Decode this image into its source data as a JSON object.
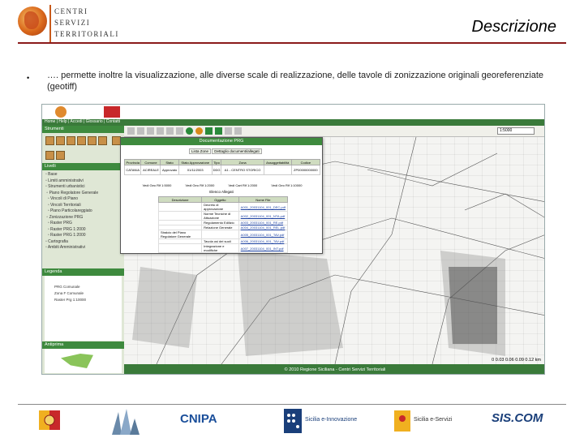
{
  "header": {
    "logo_lines": [
      "CENTRI",
      "SERVIZI",
      "TERRITORIALI"
    ],
    "title": "Descrizione"
  },
  "bullet": {
    "marker": "•",
    "text": "…. permette inoltre la visualizzazione, alle diverse scale di realizzazione, delle tavole di zonizzazione originali georeferenziate (geotiff)"
  },
  "app": {
    "nav_text": "Home | Help | Accedi | Glossario | Contatti",
    "tools_title": "Strumenti",
    "layers_title": "Livelli",
    "legend_title": "Legenda",
    "overview_title": "Antiprima",
    "layers": [
      "Base",
      "Limiti amministrativi",
      "Strumenti urbanistici",
      "Piano Regolatore Generale",
      "Vincoli di Piano",
      "Vincoli Territoriali",
      "Piano Particolareggiato",
      "Zonizzazione PRG",
      "Raster PRG",
      "Raster PRG 1:2000",
      "Raster PRG 1:2000",
      "Cartografia",
      "Ambiti Amministrativi"
    ],
    "legend_items": [
      "PRG Comunale",
      "Zona F Comunale",
      "Raster Prg 1:10000"
    ],
    "scale_value": "1:5000",
    "footer_text": "© 2010 Regione Siciliana - Centri Servizi Territoriali",
    "map_scale": "0   0.03   0.06   0.09   0.12 km",
    "popup": {
      "title": "Documentazione PRG",
      "tabs": [
        "Lista Zone",
        "Dettaglio documenti/allegati"
      ],
      "columns": [
        "Provincia",
        "Comune",
        "Stato",
        "Stato Approvazione",
        "Tipo",
        "Zona",
        "Assoggettabilità",
        "Codice"
      ],
      "row": [
        "CATANIA",
        "ACIREALE",
        "Approvato",
        "01/11/2003",
        "DDG",
        "A1 - CENTRO STORICO",
        "",
        "ZP00000000000"
      ],
      "actions": [
        "Vedi Geo Rif 1:5000",
        "Vedi Geo Rif 1:2000",
        "Vedi Cart Rif 1:2000",
        "Vedi Geo Rif 1:10000",
        "Vedi Geo Rif 1:2000",
        "Vedi Geo Rif 1:2000"
      ],
      "sub_title": "Elenco Allegati",
      "doc_columns": [
        "Descrizione",
        "Oggetto",
        "Nome File"
      ],
      "docs": [
        [
          "",
          "Decreto di approvazione",
          "A001_20031104_001_DEC.pdf"
        ],
        [
          "",
          "Norme Tecniche di Attuazione",
          "A002_20031104_001_NTA.pdf"
        ],
        [
          "",
          "Regolamento Edilizio",
          "A003_20031104_001_RE.pdf"
        ],
        [
          "",
          "Relazione Generale",
          "A004_20031104_001_REL.pdf"
        ],
        [
          "Stralcio del Piano Regolatore Generale",
          "",
          "A005_20031104_001_TAV.pdf"
        ],
        [
          "",
          "Tavola usi dei suoli",
          "A006_20031104_001_TAV.pdf"
        ],
        [
          "",
          "Integrazione e modifiche",
          "A007_20031104_001_INT.pdf"
        ]
      ]
    }
  },
  "footer_logos": [
    "Regione Siciliana",
    "Centri Servizi Territoriali",
    "CNIPA",
    "Sicilia e-Innovazione",
    "Sicilia e-Servizi",
    "SIS.COM"
  ],
  "colors": {
    "title_rule": "#8b1a1a",
    "app_green": "#3e8a3e",
    "panel_bg": "#dfe7d5"
  }
}
